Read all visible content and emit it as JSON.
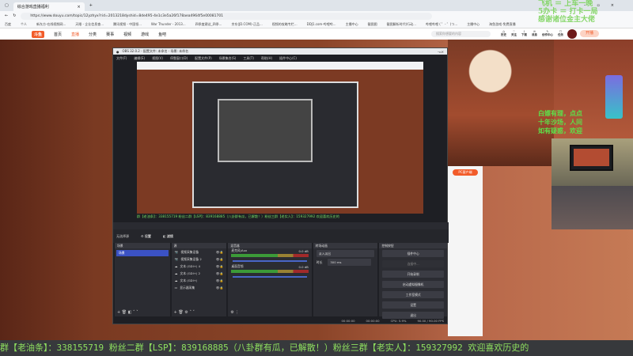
{
  "browser": {
    "tab_title": "综合游戏直播福利",
    "url": "https://www.douyu.com/topic/12yzhyx?rid=2013218dyshid=8de495-4e1c3e5a26f178aea4964f5e00081701",
    "bookmarks": [
      "百度",
      "个人",
      "新东方-在线视频网...",
      "天眼 - 企业信息查...",
      "腾讯视频 - 中国领...",
      "War Thunder - 2013...",
      "四季度建议_四季...",
      "京东(JD.COM)-正品...",
      "视频的攻略专栏...",
      "DDJ1.com-哔哩哔...",
      "主播中心",
      "截图图",
      "截图解析时代(行动...",
      "哔哩哔哩 ( ゜- ゜)つ...",
      "主播中心",
      "海鱼游戏-免费直播"
    ]
  },
  "site": {
    "logo": "斗鱼",
    "nav": [
      "首页",
      "直播",
      "分类",
      "赛事",
      "视频",
      "游戏",
      "鱼吧"
    ],
    "active_nav": "直播",
    "search_placeholder": "搜索你想要的内容",
    "icons": [
      "历史",
      "关注",
      "下载",
      "消息",
      "创作中心",
      "任务"
    ],
    "live_button": "开播"
  },
  "overlay": {
    "top_lines": [
      "飞机 ＝ 上车一晚",
      "5办卡 ＝ 打卡一局",
      "感谢诸位金主大佬"
    ],
    "right_lines": [
      "白嫖有理，点点",
      "十年沙场，人间",
      "如有疑惑，欢迎"
    ]
  },
  "chat": {
    "pc_button": "PC客户端"
  },
  "obs": {
    "title": "OBS 32.0.2 - 配置文件: 未命名 - 场景: 未命名",
    "menu": [
      "文件(F)",
      "编辑(E)",
      "视图(V)",
      "停靠窗口(D)",
      "配置文件(P)",
      "场景集合(S)",
      "工具(T)",
      "帮助(H)",
      "插件中心(C)"
    ],
    "ticker": "群【老油条】：338155719 粉丝二群【LSP】：839168885（八卦群有瓜，已解散！）粉丝三群【老实人】：159327992 欢迎喜欢历史的",
    "scene_bar": {
      "label": "无选择源",
      "settings": "设置",
      "filters": "滤镜"
    },
    "docks": {
      "scenes": {
        "title": "场景",
        "items": [
          "场景"
        ]
      },
      "sources": {
        "title": "源",
        "items": [
          "视频采集设备",
          "视频采集设备 2",
          "文本 (GDI+) 4",
          "文本 (GDI+) 2",
          "文本 (GDI+)",
          "显示器采集"
        ]
      },
      "mixer": {
        "title": "混音器",
        "channels": [
          {
            "name": "麦克风/Aux",
            "db": "0.0 dB"
          },
          {
            "name": "桌面音频",
            "db": "0.0 dB"
          }
        ]
      },
      "transitions": {
        "title": "转场动画",
        "type": "淡入淡出",
        "duration_label": "时长",
        "duration": "300 ms"
      },
      "controls": {
        "title": "控制按钮",
        "buttons": [
          "插件中心",
          "开始直播",
          "开始录制",
          "启动虚拟摄像机",
          "工作室模式",
          "设置",
          "退出"
        ],
        "status_button": "连接中..."
      }
    },
    "status": {
      "time1": "00:00:00",
      "time2": "00:00:00",
      "cpu": "CPU: 5.9%",
      "fps": "90.00 / 90.00 FPS"
    }
  },
  "bottom_ticker": "群【老油条】：338155719 粉丝二群【LSP】：839168885（八卦群有瓜，已解散！）粉丝三群【老实人】：159327992 欢迎喜欢历史的"
}
